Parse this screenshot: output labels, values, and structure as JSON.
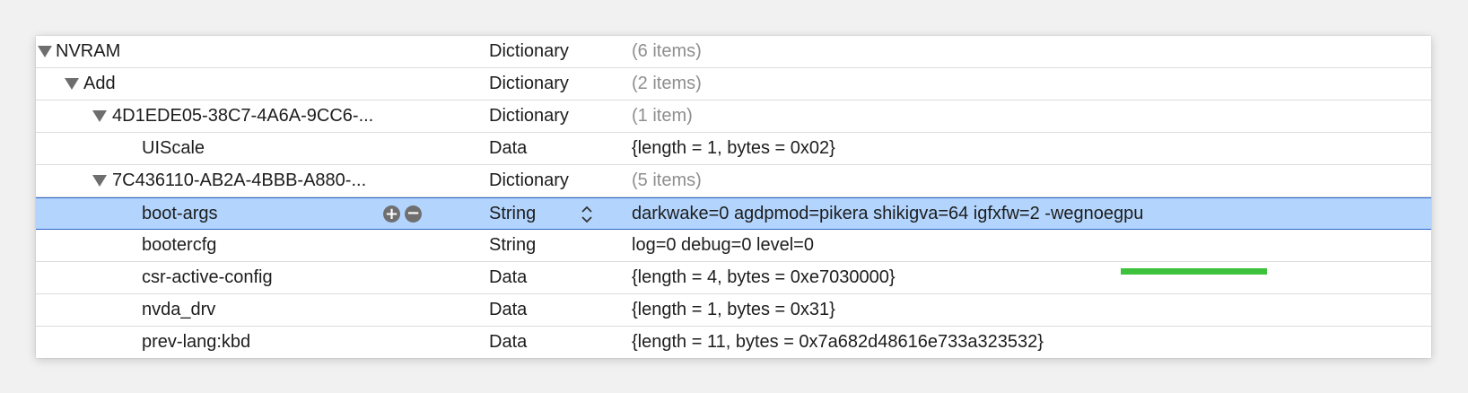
{
  "rows": [
    {
      "key": "NVRAM",
      "type": "Dictionary",
      "value": "(6 items)"
    },
    {
      "key": "Add",
      "type": "Dictionary",
      "value": "(2 items)"
    },
    {
      "key": "4D1EDE05-38C7-4A6A-9CC6-...",
      "type": "Dictionary",
      "value": "(1 item)"
    },
    {
      "key": "UIScale",
      "type": "Data",
      "value": "{length = 1, bytes = 0x02}"
    },
    {
      "key": "7C436110-AB2A-4BBB-A880-...",
      "type": "Dictionary",
      "value": "(5 items)"
    },
    {
      "key": "boot-args",
      "type": "String",
      "value": "darkwake=0 agdpmod=pikera shikigva=64 igfxfw=2 -wegnoegpu"
    },
    {
      "key": "bootercfg",
      "type": "String",
      "value": "log=0 debug=0 level=0"
    },
    {
      "key": "csr-active-config",
      "type": "Data",
      "value": "{length = 4, bytes = 0xe7030000}"
    },
    {
      "key": "nvda_drv",
      "type": "Data",
      "value": "{length = 1, bytes = 0x31}"
    },
    {
      "key": "prev-lang:kbd",
      "type": "Data",
      "value": "{length = 11, bytes = 0x7a682d48616e733a323532}"
    }
  ],
  "selected_row_controls": {
    "add_symbol": "+",
    "remove_symbol": "−"
  },
  "colors": {
    "selection": "#b3d5fd",
    "selection_border": "#2b63c9",
    "highlight_underline": "#3ec23e"
  }
}
